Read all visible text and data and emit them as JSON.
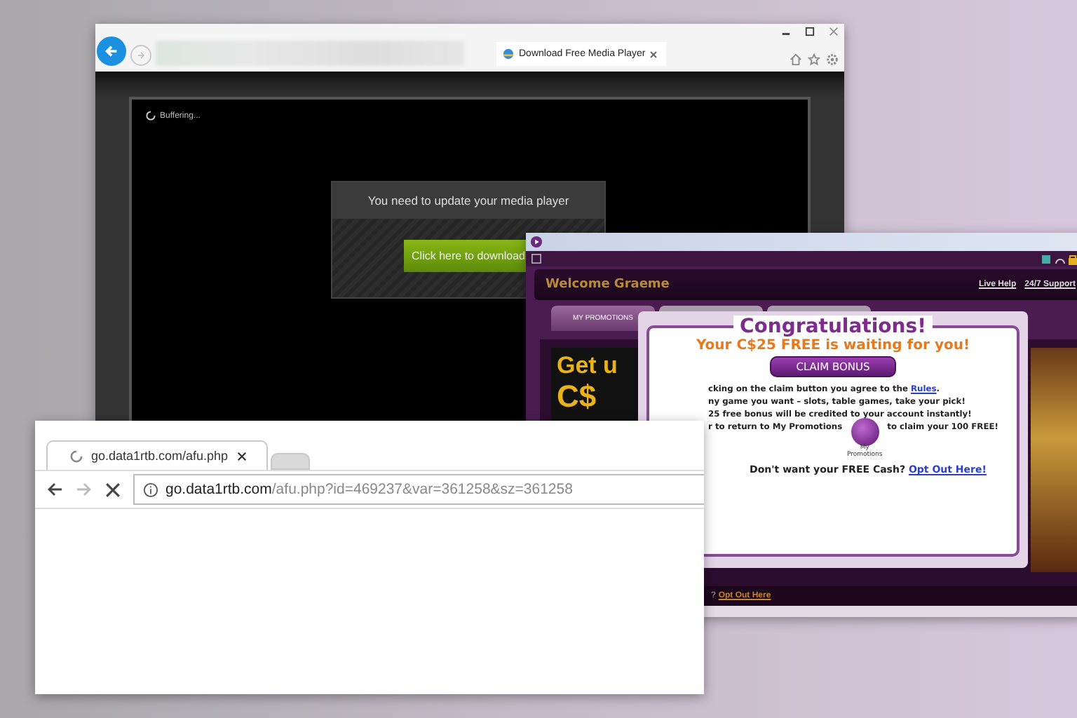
{
  "ie_window": {
    "tab": {
      "label": "Download Free Media Player",
      "selected": true
    },
    "player": {
      "status": "Buffering...",
      "prompt": "You need to update your media player",
      "button": "Click here to download"
    }
  },
  "casino_window": {
    "welcome": "Welcome Graeme",
    "links": [
      "Live Help",
      "24/7 Support"
    ],
    "tabs": [
      {
        "label": "MY PROMOTIONS",
        "selected": true
      },
      {
        "selected": false
      },
      {
        "selected": false
      }
    ],
    "banner": [
      "Get u",
      "C$"
    ],
    "footer_prefix": "?",
    "footer_link": "Opt Out Here",
    "popup": {
      "title": "Congratulations!",
      "subtitle": "Your C$25 FREE is waiting for you!",
      "button": "CLAIM BONUS",
      "lines": [
        {
          "kind": "link",
          "text": "cking on the claim button you agree to the ",
          "link": "Rules",
          "after": "."
        },
        {
          "kind": "plain",
          "text": "ny game you want – slots, table games, take your pick!"
        },
        {
          "kind": "plain",
          "text": "25 free bonus will be credited to your account instantly!"
        },
        {
          "kind": "promo",
          "text": "r to return to My Promotions",
          "icon_label": "My Promotions",
          "after": "to claim your 100 FREE!"
        }
      ],
      "opt_out": {
        "text": "Don't want your FREE Cash? ",
        "link": "Opt Out Here!"
      }
    }
  },
  "chrome_window": {
    "tabs": [
      {
        "label": "go.data1rtb.com/afu.php",
        "selected": true,
        "loading": true
      },
      {
        "selected": false,
        "loading": false
      }
    ],
    "address": {
      "host": "go.data1rtb.com",
      "path": "/afu.php?id=469237&var=361258&sz=361258"
    }
  }
}
